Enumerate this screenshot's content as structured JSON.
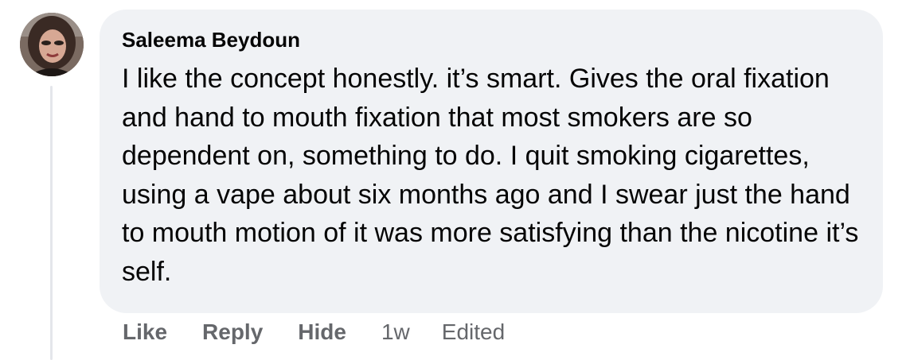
{
  "comment": {
    "author": "Saleema Beydoun",
    "avatar_icon": "profile-photo-avatar",
    "text": "I like the concept honestly. it’s smart. Gives the oral fixation and hand to mouth fixation that most smokers are so dependent on, something to do. I quit smoking cigarettes, using a vape about six months ago and I swear just the hand to mouth motion of it was more satisfying than the nicotine it’s self.",
    "bubble_color": "#f0f2f5",
    "text_color": "#050505"
  },
  "actions": {
    "like_label": "Like",
    "reply_label": "Reply",
    "hide_label": "Hide",
    "timestamp": "1w",
    "edited_label": "Edited",
    "color": "#65676b"
  }
}
